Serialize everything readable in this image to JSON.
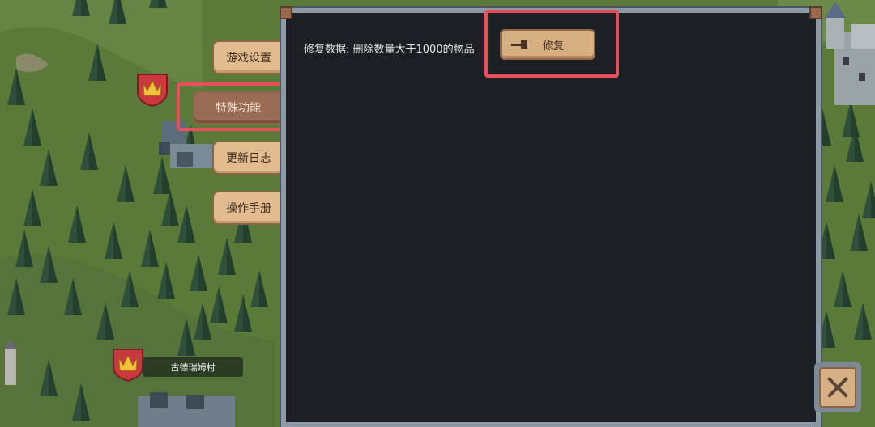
{
  "sidebar": {
    "tabs": [
      {
        "label": "游戏设置"
      },
      {
        "label": "特殊功能"
      },
      {
        "label": "更新日志"
      },
      {
        "label": "操作手册"
      }
    ],
    "active_tab": "特殊功能"
  },
  "panel": {
    "repair_row": {
      "label": "修复数据: 删除数量大于1000的物品",
      "button_label": "修复",
      "button_icon": "hammer-icon"
    }
  },
  "map": {
    "village_name": "古德瑞姆村"
  },
  "close_button": {
    "icon": "close-icon"
  },
  "colors": {
    "highlight": "#e8505d",
    "panel_bg": "#1c2024",
    "panel_border": "#8d9aa6",
    "tab_bg": "#e2bc8e",
    "tab_active_bg": "#9a6c55",
    "grass": "#5d7d3a"
  }
}
